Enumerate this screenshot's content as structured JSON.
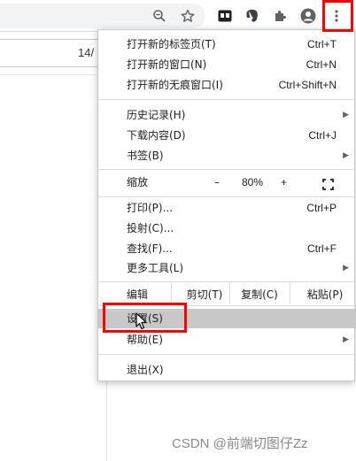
{
  "toolbar": {
    "icons": [
      "zoom-icon",
      "star-icon",
      "extension-app-icon",
      "evernote-icon",
      "puzzle-icon",
      "account-icon",
      "more-vert-icon"
    ]
  },
  "page": {
    "visible_text": "14/"
  },
  "menu": {
    "items": [
      {
        "label": "打开新的标签页(T)",
        "shortcut": "Ctrl+T"
      },
      {
        "label": "打开新的窗口(N)",
        "shortcut": "Ctrl+N"
      },
      {
        "label": "打开新的无痕窗口(I)",
        "shortcut": "Ctrl+Shift+N"
      },
      {
        "label": "历史记录(H)",
        "shortcut": ""
      },
      {
        "label": "下载内容(D)",
        "shortcut": "Ctrl+J"
      },
      {
        "label": "书签(B)",
        "shortcut": ""
      },
      {
        "label": "打印(P)...",
        "shortcut": "Ctrl+P"
      },
      {
        "label": "投射(C)...",
        "shortcut": ""
      },
      {
        "label": "查找(F)...",
        "shortcut": "Ctrl+F"
      },
      {
        "label": "更多工具(L)",
        "shortcut": ""
      },
      {
        "label": "设置(S)",
        "shortcut": ""
      },
      {
        "label": "帮助(E)",
        "shortcut": ""
      },
      {
        "label": "退出(X)",
        "shortcut": ""
      }
    ],
    "zoom": {
      "label": "缩放",
      "minus": "–",
      "value": "80%",
      "plus": "+"
    },
    "edit": {
      "label": "编辑",
      "cut": "剪切(T)",
      "copy": "复制(C)",
      "paste": "粘贴(P)"
    }
  },
  "watermark": "CSDN @前端切图仔Zz",
  "colors": {
    "highlight_box": "#ff0000",
    "hover_row": "#c8c8c8"
  }
}
